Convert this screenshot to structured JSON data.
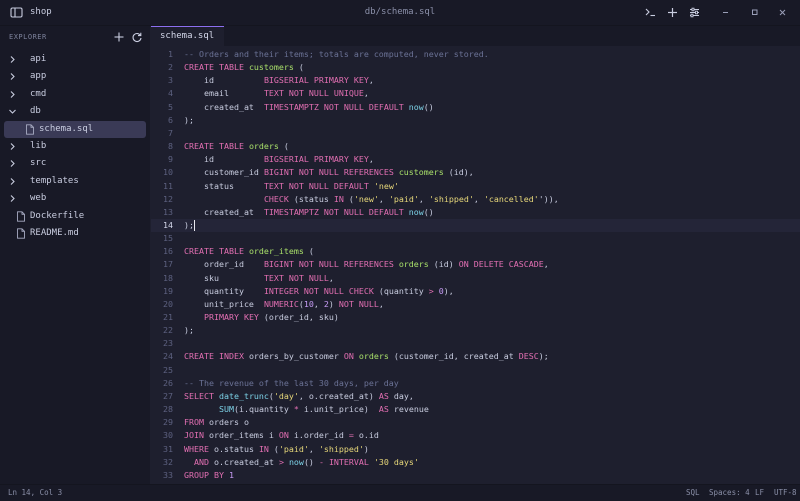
{
  "window": {
    "app_name": "shop",
    "file_path": "db/schema.sql",
    "icons": [
      "sidebar-toggle-icon",
      "terminal-icon",
      "plus-icon",
      "sliders-icon",
      "minimize-icon",
      "maximize-icon",
      "close-icon"
    ]
  },
  "sidebar": {
    "heading": "EXPLORER",
    "items": [
      {
        "label": "api",
        "type": "folder"
      },
      {
        "label": "app",
        "type": "folder"
      },
      {
        "label": "cmd",
        "type": "folder"
      },
      {
        "label": "db",
        "type": "folder-open"
      },
      {
        "label": "schema.sql",
        "type": "file",
        "selected": true
      },
      {
        "label": "lib",
        "type": "folder"
      },
      {
        "label": "src",
        "type": "folder"
      },
      {
        "label": "templates",
        "type": "folder"
      },
      {
        "label": "web",
        "type": "folder"
      },
      {
        "label": "Dockerfile",
        "type": "file"
      },
      {
        "label": "README.md",
        "type": "file"
      }
    ]
  },
  "tabs": [
    {
      "label": "schema.sql",
      "active": true
    }
  ],
  "editor": {
    "active_line": 14,
    "lines": [
      [
        [
          "cm",
          "-- Orders and their items; totals are computed, never stored."
        ]
      ],
      [
        [
          "kw",
          "CREATE TABLE "
        ],
        [
          "fn",
          "customers"
        ],
        [
          "p",
          " ("
        ]
      ],
      [
        [
          "p",
          "    id          "
        ],
        [
          "kw",
          "BIGSERIAL PRIMARY KEY"
        ],
        [
          "p",
          ","
        ]
      ],
      [
        [
          "p",
          "    email       "
        ],
        [
          "kw",
          "TEXT NOT NULL UNIQUE"
        ],
        [
          "p",
          ","
        ]
      ],
      [
        [
          "p",
          "    created_at  "
        ],
        [
          "kw",
          "TIMESTAMPTZ NOT NULL DEFAULT "
        ],
        [
          "ty",
          "now"
        ],
        [
          "p",
          "()"
        ]
      ],
      [
        [
          "p",
          ");"
        ]
      ],
      [],
      [
        [
          "kw",
          "CREATE TABLE "
        ],
        [
          "fn",
          "orders"
        ],
        [
          "p",
          " ("
        ]
      ],
      [
        [
          "p",
          "    id          "
        ],
        [
          "kw",
          "BIGSERIAL PRIMARY KEY"
        ],
        [
          "p",
          ","
        ]
      ],
      [
        [
          "p",
          "    customer_id "
        ],
        [
          "kw",
          "BIGINT NOT NULL REFERENCES "
        ],
        [
          "fn",
          "customers"
        ],
        [
          "p",
          " (id),"
        ]
      ],
      [
        [
          "p",
          "    status      "
        ],
        [
          "kw",
          "TEXT NOT NULL DEFAULT "
        ],
        [
          "st",
          "'new'"
        ]
      ],
      [
        [
          "p",
          "                "
        ],
        [
          "kw",
          "CHECK"
        ],
        [
          "p",
          " (status "
        ],
        [
          "kw",
          "IN"
        ],
        [
          "p",
          " ("
        ],
        [
          "st",
          "'new'"
        ],
        [
          "p",
          ", "
        ],
        [
          "st",
          "'paid'"
        ],
        [
          "p",
          ", "
        ],
        [
          "st",
          "'shipped'"
        ],
        [
          "p",
          ", "
        ],
        [
          "st",
          "'cancelled'"
        ],
        [
          "p",
          "')),"
        ]
      ],
      [
        [
          "p",
          "    created_at  "
        ],
        [
          "kw",
          "TIMESTAMPTZ NOT NULL DEFAULT "
        ],
        [
          "ty",
          "now"
        ],
        [
          "p",
          "()"
        ]
      ],
      [
        [
          "p",
          ");"
        ]
      ],
      [],
      [
        [
          "kw",
          "CREATE TABLE "
        ],
        [
          "fn",
          "order_items"
        ],
        [
          "p",
          " ("
        ]
      ],
      [
        [
          "p",
          "    order_id    "
        ],
        [
          "kw",
          "BIGINT NOT NULL REFERENCES "
        ],
        [
          "fn",
          "orders"
        ],
        [
          "p",
          " (id) "
        ],
        [
          "kw",
          "ON DELETE CASCADE"
        ],
        [
          "p",
          ","
        ]
      ],
      [
        [
          "p",
          "    sku         "
        ],
        [
          "kw",
          "TEXT NOT NULL"
        ],
        [
          "p",
          ","
        ]
      ],
      [
        [
          "p",
          "    quantity    "
        ],
        [
          "kw",
          "INTEGER NOT NULL CHECK"
        ],
        [
          "p",
          " (quantity "
        ],
        [
          "op",
          ">"
        ],
        [
          "p",
          " "
        ],
        [
          "nu",
          "0"
        ],
        [
          "p",
          "),"
        ]
      ],
      [
        [
          "p",
          "    unit_price  "
        ],
        [
          "kw",
          "NUMERIC"
        ],
        [
          "p",
          "("
        ],
        [
          "nu",
          "10"
        ],
        [
          "p",
          ", "
        ],
        [
          "nu",
          "2"
        ],
        [
          "p",
          ") "
        ],
        [
          "kw",
          "NOT NULL"
        ],
        [
          "p",
          ","
        ]
      ],
      [
        [
          "p",
          "    "
        ],
        [
          "kw",
          "PRIMARY KEY"
        ],
        [
          "p",
          " (order_id, sku)"
        ]
      ],
      [
        [
          "p",
          ");"
        ]
      ],
      [],
      [
        [
          "kw",
          "CREATE INDEX "
        ],
        [
          "p",
          "orders_by_customer "
        ],
        [
          "kw",
          "ON "
        ],
        [
          "fn",
          "orders"
        ],
        [
          "p",
          " (customer_id, created_at "
        ],
        [
          "kw",
          "DESC"
        ],
        [
          "p",
          ");"
        ]
      ],
      [],
      [
        [
          "cm",
          "-- The revenue of the last 30 days, per day"
        ]
      ],
      [
        [
          "kw",
          "SELECT "
        ],
        [
          "ty",
          "date_trunc"
        ],
        [
          "p",
          "("
        ],
        [
          "st",
          "'day'"
        ],
        [
          "p",
          ", o.created_at) "
        ],
        [
          "kw",
          "AS"
        ],
        [
          "p",
          " day,"
        ]
      ],
      [
        [
          "p",
          "       "
        ],
        [
          "ty",
          "SUM"
        ],
        [
          "p",
          "(i.quantity "
        ],
        [
          "op",
          "*"
        ],
        [
          "p",
          " i.unit_price)  "
        ],
        [
          "kw",
          "AS"
        ],
        [
          "p",
          " revenue"
        ]
      ],
      [
        [
          "kw",
          "FROM"
        ],
        [
          "p",
          " orders o"
        ]
      ],
      [
        [
          "kw",
          "JOIN"
        ],
        [
          "p",
          " order_items i "
        ],
        [
          "kw",
          "ON"
        ],
        [
          "p",
          " i.order_id "
        ],
        [
          "op",
          "="
        ],
        [
          "p",
          " o.id"
        ]
      ],
      [
        [
          "kw",
          "WHERE"
        ],
        [
          "p",
          " o.status "
        ],
        [
          "kw",
          "IN"
        ],
        [
          "p",
          " ("
        ],
        [
          "st",
          "'paid'"
        ],
        [
          "p",
          ", "
        ],
        [
          "st",
          "'shipped'"
        ],
        [
          "p",
          ")"
        ]
      ],
      [
        [
          "p",
          "  "
        ],
        [
          "kw",
          "AND"
        ],
        [
          "p",
          " o.created_at "
        ],
        [
          "op",
          ">"
        ],
        [
          "p",
          " "
        ],
        [
          "ty",
          "now"
        ],
        [
          "p",
          "() "
        ],
        [
          "op",
          "-"
        ],
        [
          "p",
          " "
        ],
        [
          "kw",
          "INTERVAL "
        ],
        [
          "st",
          "'30 days'"
        ]
      ],
      [
        [
          "kw",
          "GROUP BY "
        ],
        [
          "nu",
          "1"
        ]
      ]
    ]
  },
  "statusbar": {
    "position": "Ln 14, Col 3",
    "language": "SQL",
    "indent": "Spaces: 4",
    "eol": "LF",
    "encoding": "UTF-8"
  }
}
